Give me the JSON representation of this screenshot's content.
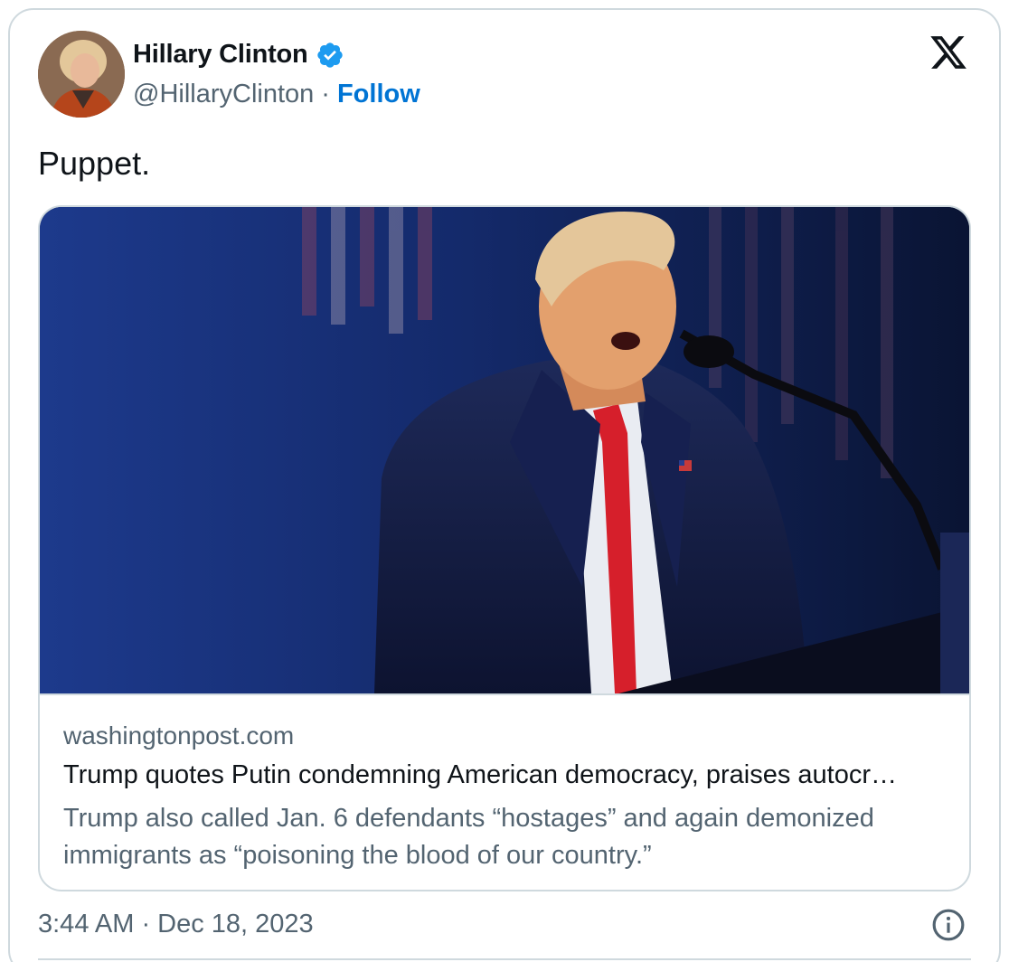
{
  "author": {
    "name": "Hillary Clinton",
    "handle": "@HillaryClinton",
    "separator": "·",
    "follow_label": "Follow",
    "verified": true,
    "verified_color": "#1d9bf0"
  },
  "tweet": {
    "text": "Puppet."
  },
  "link_card": {
    "domain": "washingtonpost.com",
    "headline": "Trump quotes Putin condemning American democracy, praises autocr…",
    "description_line1": "Trump also called Jan. 6 defendants “hostages” and again demonized",
    "description_line2": "immigrants as “poisoning the blood of our country.”"
  },
  "meta": {
    "timestamp": "3:44 AM · Dec 18, 2023"
  },
  "icons": {
    "platform": "x-logo-icon",
    "info": "info-icon",
    "verified": "verified-badge-icon"
  },
  "colors": {
    "link_blue": "#0074d4",
    "muted": "#536471",
    "border": "#cfd9de"
  }
}
